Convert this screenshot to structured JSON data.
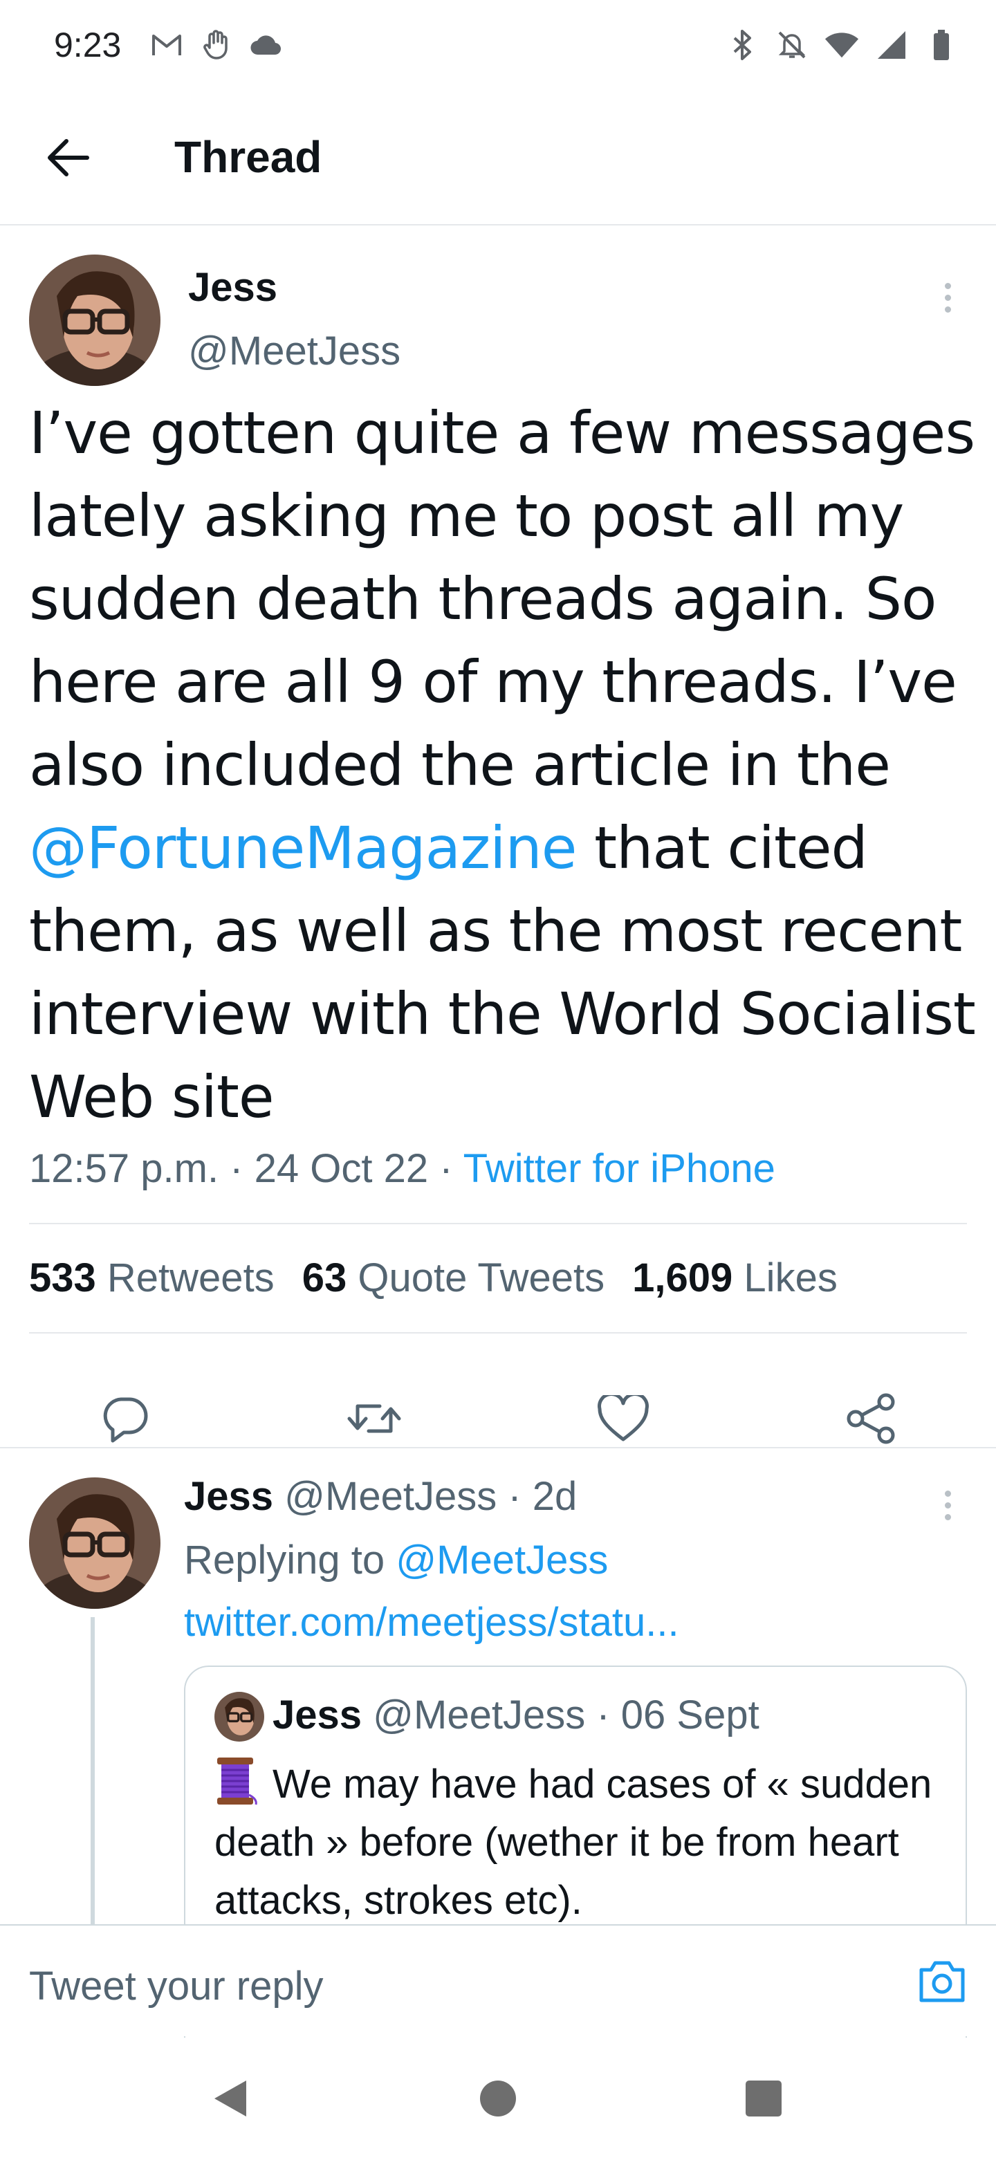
{
  "status_bar": {
    "time": "9:23",
    "left_icons": [
      "gmail-icon",
      "hand-icon",
      "cloud-icon"
    ],
    "right_icons": [
      "bluetooth-icon",
      "mute-icon",
      "wifi-icon",
      "signal-icon",
      "battery-icon"
    ]
  },
  "header": {
    "title": "Thread"
  },
  "main_tweet": {
    "name": "Jess",
    "handle": "@MeetJess",
    "text_before": "I’ve gotten quite a few messages lately asking me to post all my sudden death threads again. So here are all 9 of my threads. I’ve also included the article in the ",
    "mention": "@FortuneMagazine",
    "text_after": " that cited them, as well as the most recent interview with the World Socialist Web site",
    "time": "12:57 p.m.",
    "date": "24 Oct 22",
    "source": "Twitter for iPhone",
    "separator": " · ",
    "stats": {
      "retweets_count": "533",
      "retweets_label": "Retweets",
      "quotes_count": "63",
      "quotes_label": "Quote Tweets",
      "likes_count": "1,609",
      "likes_label": "Likes"
    }
  },
  "reply": {
    "name": "Jess",
    "handle": "@MeetJess",
    "age": "2d",
    "replying_prefix": "Replying to ",
    "replying_to": "@MeetJess",
    "link": "twitter.com/meetjess/statu...",
    "quote": {
      "name": "Jess",
      "handle": "@MeetJess",
      "date": "06 Sept",
      "text": "We may have had cases of « sudden death » before (wether it be from heart attacks, strokes etc)."
    }
  },
  "composer": {
    "placeholder": "Tweet your reply"
  },
  "colors": {
    "accent": "#1d9bf0",
    "text": "#0f1419",
    "secondary": "#536471",
    "divider": "#e5e8eb"
  }
}
